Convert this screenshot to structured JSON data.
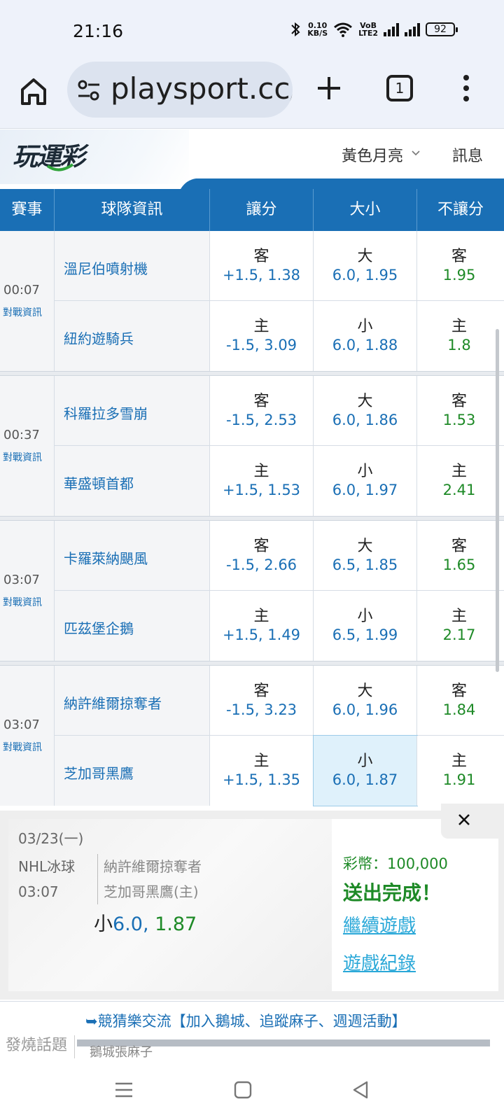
{
  "status": {
    "time": "21:16",
    "net_speed_top": "0.10",
    "net_speed_bottom": "KB/S",
    "volte_top": "VoB",
    "volte_bottom": "LTE2",
    "battery": "92"
  },
  "browser": {
    "url": "playsport.cc/",
    "tab_count": "1"
  },
  "site": {
    "logo": "玩運彩",
    "user_name": "黃色月亮",
    "messages": "訊息"
  },
  "table": {
    "headers": [
      "賽事",
      "球隊資訊",
      "讓分",
      "大小",
      "不讓分"
    ],
    "vs_label": "對戰資訊",
    "games": [
      {
        "time": "00:07",
        "rows": [
          {
            "team": "溫尼伯噴射機",
            "spread_side": "客",
            "spread_val": "+1.5, 1.38",
            "ou_side": "大",
            "ou_val": "6.0, 1.95",
            "ml_side": "客",
            "ml_val": "1.95"
          },
          {
            "team": "紐約遊騎兵",
            "spread_side": "主",
            "spread_val": "-1.5, 3.09",
            "ou_side": "小",
            "ou_val": "6.0, 1.88",
            "ml_side": "主",
            "ml_val": "1.8"
          }
        ]
      },
      {
        "time": "00:37",
        "rows": [
          {
            "team": "科羅拉多雪崩",
            "spread_side": "客",
            "spread_val": "-1.5, 2.53",
            "ou_side": "大",
            "ou_val": "6.0, 1.86",
            "ml_side": "客",
            "ml_val": "1.53"
          },
          {
            "team": "華盛頓首都",
            "spread_side": "主",
            "spread_val": "+1.5, 1.53",
            "ou_side": "小",
            "ou_val": "6.0, 1.97",
            "ml_side": "主",
            "ml_val": "2.41"
          }
        ]
      },
      {
        "time": "03:07",
        "rows": [
          {
            "team": "卡羅萊納颶風",
            "spread_side": "客",
            "spread_val": "-1.5, 2.66",
            "ou_side": "大",
            "ou_val": "6.5, 1.85",
            "ml_side": "客",
            "ml_val": "1.65"
          },
          {
            "team": "匹茲堡企鵝",
            "spread_side": "主",
            "spread_val": "+1.5, 1.49",
            "ou_side": "小",
            "ou_val": "6.5, 1.99",
            "ml_side": "主",
            "ml_val": "2.17"
          }
        ]
      },
      {
        "time": "03:07",
        "rows": [
          {
            "team": "納許維爾掠奪者",
            "spread_side": "客",
            "spread_val": "-1.5, 3.23",
            "ou_side": "大",
            "ou_val": "6.0, 1.96",
            "ml_side": "客",
            "ml_val": "1.84"
          },
          {
            "team": "芝加哥黑鷹",
            "spread_side": "主",
            "spread_val": "+1.5, 1.35",
            "ou_side": "小",
            "ou_val": "6.0, 1.87",
            "ml_side": "主",
            "ml_val": "1.91"
          }
        ]
      }
    ]
  },
  "bet_panel": {
    "date": "03/23(一)",
    "league": "NHL冰球",
    "time": "03:07",
    "team_away": "納許維爾掠奪者",
    "team_home": "芝加哥黑鷹(主)",
    "pick_side": "小",
    "pick_value": "6.0,",
    "pick_odds": " 1.87",
    "coins": "彩幣：100,000",
    "done": "送出完成！",
    "continue": "繼續遊戲",
    "record": "遊戲紀錄",
    "close": "×"
  },
  "footer": {
    "label": "發燒話題",
    "link": "➥競猜樂交流【加入鵝城、追蹤麻子、週週活動】",
    "sub": "鵝城張麻子"
  },
  "colors": {
    "header_blue": "#1a6fb5",
    "odds_green": "#1e8a27",
    "selected_cell": "#dff1fb",
    "link_cyan": "#2aa8d8"
  }
}
